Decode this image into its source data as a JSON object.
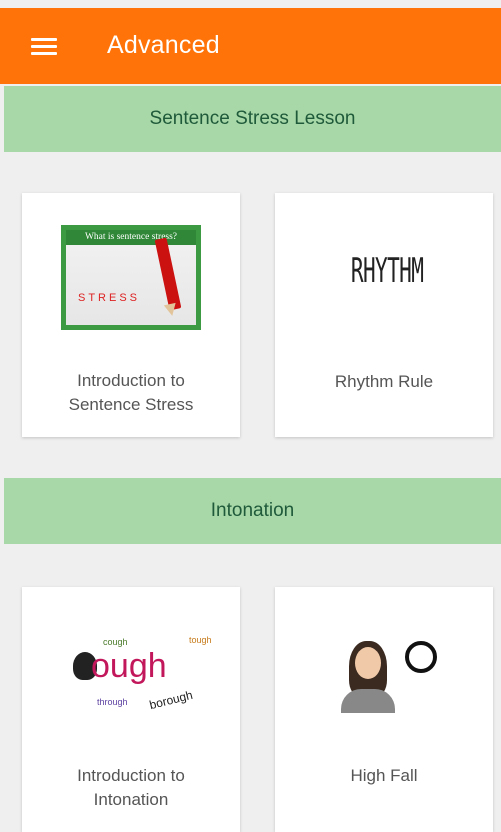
{
  "toolbar": {
    "title": "Advanced",
    "menu_icon": "hamburger-menu-icon"
  },
  "sections": [
    {
      "title": "Sentence Stress Lesson",
      "cards": [
        {
          "label_line1": "Introduction to",
          "label_line2": "Sentence Stress",
          "image_caption": "What is sentence stress?",
          "image_word": "STRESS"
        },
        {
          "label": "Rhythm Rule",
          "image_text": "RHYTHM"
        }
      ]
    },
    {
      "title": "Intonation",
      "cards": [
        {
          "label_line1": "Introduction to",
          "label_line2": "Intonation",
          "image_word": "ough",
          "image_small": [
            "cough",
            "tough",
            "through",
            "borough"
          ]
        },
        {
          "label": "High Fall"
        }
      ]
    }
  ],
  "colors": {
    "toolbar": "#ff7309",
    "section_header": "#a8d8a8",
    "section_text": "#1f5a3a",
    "background": "#efefef"
  }
}
